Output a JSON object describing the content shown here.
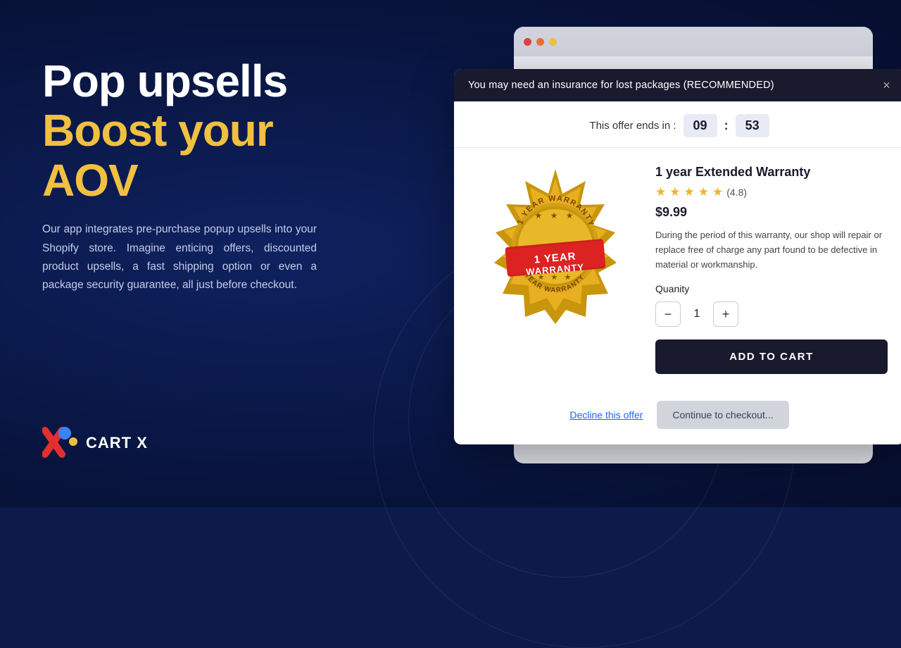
{
  "background": {
    "color": "#0d1b4b"
  },
  "left_panel": {
    "headline_line1": "Pop upsells",
    "headline_line2": "Boost your",
    "headline_line3": "AOV",
    "description": "Our app integrates pre-purchase popup upsells into your Shopify store. Imagine enticing offers, discounted product upsells, a fast shipping option or even a package security guarantee, all just before checkout.",
    "logo_text": "CART X"
  },
  "browser": {
    "dots": [
      "yellow",
      "orange",
      "red"
    ]
  },
  "popup": {
    "header_text": "You may need an insurance for lost packages (RECOMMENDED)",
    "close_label": "×",
    "timer_label": "This offer ends in :",
    "timer_minutes": "09",
    "timer_seconds": "53",
    "product": {
      "title": "1 year Extended Warranty",
      "rating_stars": 4.8,
      "rating_count": "(4.8)",
      "price": "$9.99",
      "description": "During the period of this warranty, our shop will repair or replace free of charge any part found to be defective in material or workmanship.",
      "quantity_label": "Quanity",
      "quantity_value": "1",
      "add_to_cart_label": "ADD TO CART"
    },
    "footer": {
      "decline_label": "Decline this offer",
      "continue_label": "Continue to checkout..."
    }
  }
}
